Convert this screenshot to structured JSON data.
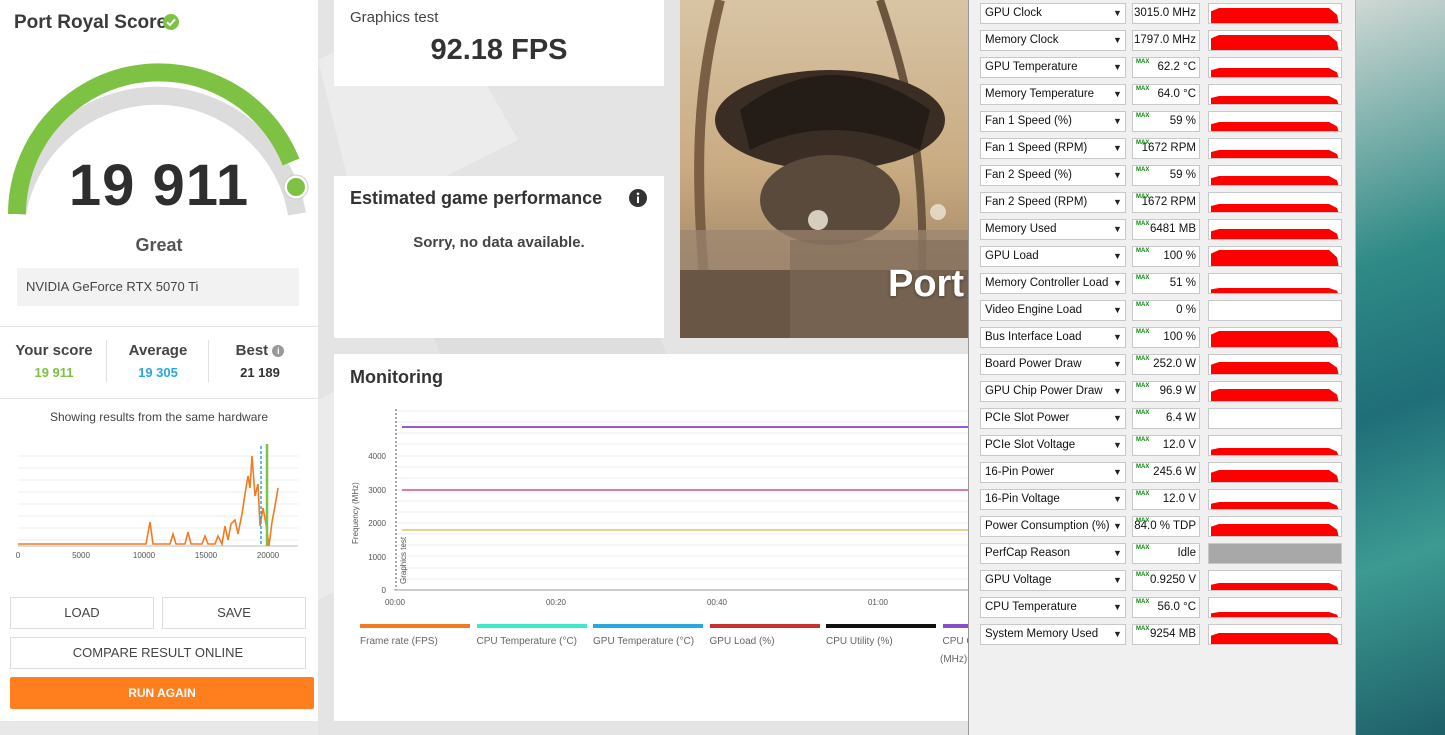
{
  "left": {
    "title": "Port Royal Score",
    "score": "19 911",
    "rating": "Great",
    "gpu_name": "NVIDIA GeForce RTX 5070 Ti",
    "your_score_label": "Your score",
    "your_score_value": "19 911",
    "average_label": "Average",
    "average_value": "19 305",
    "best_label": "Best",
    "best_value": "21 189",
    "hardware_note": "Showing results from the same hardware",
    "buttons": {
      "load": "LOAD",
      "save": "SAVE",
      "compare": "COMPARE RESULT ONLINE",
      "run_again": "RUN AGAIN"
    },
    "colors": {
      "gauge_green": "#7dc242",
      "your_score": "#7dc242",
      "average": "#29a8e0",
      "run_again": "#ff7f1f"
    },
    "distribution_axis": [
      "0",
      "5000",
      "10000",
      "15000",
      "20000"
    ]
  },
  "center": {
    "graphics_test_label": "Graphics test",
    "graphics_test_fps": "92.18 FPS",
    "est_title": "Estimated game performance",
    "est_message": "Sorry, no data available.",
    "art_title": "Port",
    "monitoring_title": "Monitoring",
    "monitoring_y_label": "Frequency (MHz)",
    "monitoring_marker_label": "Graphics test",
    "monitoring_y_ticks": [
      "4000",
      "3000",
      "2000",
      "1000",
      "0"
    ],
    "monitoring_x_ticks": [
      "00:00",
      "00:20",
      "00:40",
      "01:00"
    ],
    "legend": [
      {
        "label": "Frame rate (FPS)",
        "color": "#f07b22"
      },
      {
        "label": "CPU Temperature (°C)",
        "color": "#3ee8c8"
      },
      {
        "label": "GPU Temperature (°C)",
        "color": "#29a8e0"
      },
      {
        "label": "GPU Load (%)",
        "color": "#c8302e"
      },
      {
        "label": "CPU Utility (%)",
        "color": "#111111"
      },
      {
        "label": "CPU C",
        "color": "#8a4fc8"
      }
    ],
    "legend_extra": "(MHz)"
  },
  "sensors": [
    {
      "name": "GPU Clock",
      "value": "3015.0 MHz",
      "max": false
    },
    {
      "name": "Memory Clock",
      "value": "1797.0 MHz",
      "max": false
    },
    {
      "name": "GPU Temperature",
      "value": "62.2 °C",
      "max": true
    },
    {
      "name": "Memory Temperature",
      "value": "64.0 °C",
      "max": true
    },
    {
      "name": "Fan 1 Speed (%)",
      "value": "59 %",
      "max": true
    },
    {
      "name": "Fan 1 Speed (RPM)",
      "value": "1672 RPM",
      "max": true
    },
    {
      "name": "Fan 2 Speed (%)",
      "value": "59 %",
      "max": true
    },
    {
      "name": "Fan 2 Speed (RPM)",
      "value": "1672 RPM",
      "max": true
    },
    {
      "name": "Memory Used",
      "value": "6481 MB",
      "max": true
    },
    {
      "name": "GPU Load",
      "value": "100 %",
      "max": true
    },
    {
      "name": "Memory Controller Load",
      "value": "51 %",
      "max": true
    },
    {
      "name": "Video Engine Load",
      "value": "0 %",
      "max": true
    },
    {
      "name": "Bus Interface Load",
      "value": "100 %",
      "max": true
    },
    {
      "name": "Board Power Draw",
      "value": "252.0 W",
      "max": true
    },
    {
      "name": "GPU Chip Power Draw",
      "value": "96.9 W",
      "max": true
    },
    {
      "name": "PCIe Slot Power",
      "value": "6.4 W",
      "max": true
    },
    {
      "name": "PCIe Slot Voltage",
      "value": "12.0 V",
      "max": true
    },
    {
      "name": "16-Pin Power",
      "value": "245.6 W",
      "max": true
    },
    {
      "name": "16-Pin Voltage",
      "value": "12.0 V",
      "max": true
    },
    {
      "name": "Power Consumption (%)",
      "value": "84.0 % TDP",
      "max": true
    },
    {
      "name": "PerfCap Reason",
      "value": "Idle",
      "max": true
    },
    {
      "name": "GPU Voltage",
      "value": "0.9250 V",
      "max": true
    },
    {
      "name": "CPU Temperature",
      "value": "56.0 °C",
      "max": true
    },
    {
      "name": "System Memory Used",
      "value": "9254 MB",
      "max": true
    }
  ],
  "sensor_max_label": "MAX"
}
